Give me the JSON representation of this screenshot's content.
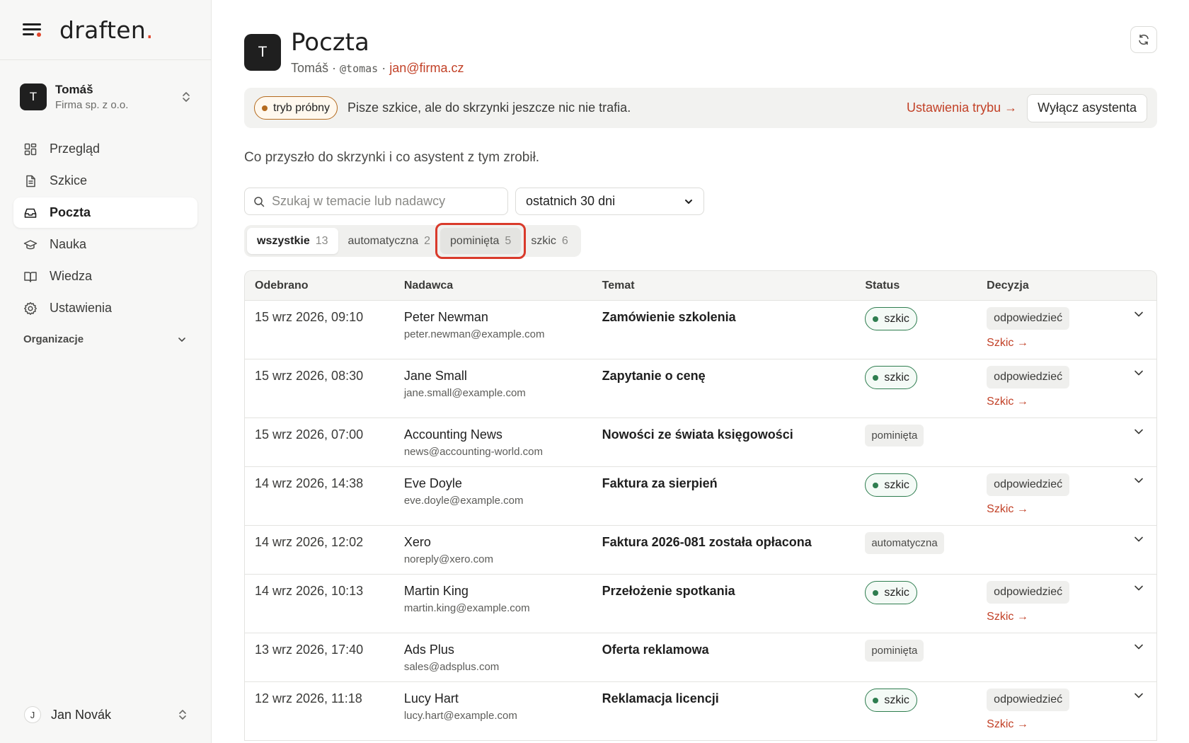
{
  "brand": {
    "logo": "draften",
    "logo_dot": "."
  },
  "account": {
    "initial": "T",
    "name": "Tomáš",
    "org": "Firma sp. z o.o."
  },
  "nav": [
    {
      "label": "Przegląd",
      "icon": "grid-icon",
      "active": false
    },
    {
      "label": "Szkice",
      "icon": "document-icon",
      "active": false
    },
    {
      "label": "Poczta",
      "icon": "inbox-icon",
      "active": true
    },
    {
      "label": "Nauka",
      "icon": "graduation-cap-icon",
      "active": false
    },
    {
      "label": "Wiedza",
      "icon": "book-icon",
      "active": false
    },
    {
      "label": "Ustawienia",
      "icon": "gear-icon",
      "active": false
    }
  ],
  "org_section": {
    "label": "Organizacje"
  },
  "user": {
    "initial": "J",
    "name": "Jan Novák"
  },
  "header": {
    "initial": "T",
    "title": "Poczta",
    "name": "Tomáš",
    "sep1": " · ",
    "handle": "@tomas",
    "sep2": " · ",
    "email": "jan@firma.cz"
  },
  "trial": {
    "pill": "tryb próbny",
    "text": "Pisze szkice, ale do skrzynki jeszcze nic nie trafia.",
    "settings_link": "Ustawienia trybu →",
    "disable_button": "Wyłącz asystenta"
  },
  "intro": "Co przyszło do skrzynki i co asystent z tym zrobił.",
  "search": {
    "placeholder": "Szukaj w temacie lub nadawcy",
    "value": ""
  },
  "range": {
    "selected": "ostatnich 30 dni"
  },
  "filters": [
    {
      "label": "wszystkie",
      "count": "13"
    },
    {
      "label": "automatyczna",
      "count": "2"
    },
    {
      "label": "pominięta",
      "count": "5"
    },
    {
      "label": "szkic",
      "count": "6"
    }
  ],
  "table": {
    "headers": {
      "date": "Odebrano",
      "from": "Nadawca",
      "subject": "Temat",
      "status": "Status",
      "decision": "Decyzja"
    },
    "rows": [
      {
        "date": "15 wrz 2026, 09:10",
        "name": "Peter Newman",
        "email": "peter.newman@example.com",
        "subject": "Zamówienie szkolenia",
        "status": "szkic",
        "decision": "odpowiedzieć",
        "link": "Szkic →"
      },
      {
        "date": "15 wrz 2026, 08:30",
        "name": "Jane Small",
        "email": "jane.small@example.com",
        "subject": "Zapytanie o cenę",
        "status": "szkic",
        "decision": "odpowiedzieć",
        "link": "Szkic →"
      },
      {
        "date": "15 wrz 2026, 07:00",
        "name": "Accounting News",
        "email": "news@accounting-world.com",
        "subject": "Nowości ze świata księgowości",
        "status": "pominięta",
        "decision": "",
        "link": ""
      },
      {
        "date": "14 wrz 2026, 14:38",
        "name": "Eve Doyle",
        "email": "eve.doyle@example.com",
        "subject": "Faktura za sierpień",
        "status": "szkic",
        "decision": "odpowiedzieć",
        "link": "Szkic →"
      },
      {
        "date": "14 wrz 2026, 12:02",
        "name": "Xero",
        "email": "noreply@xero.com",
        "subject": "Faktura 2026-081 została opłacona",
        "status": "automatyczna",
        "decision": "",
        "link": ""
      },
      {
        "date": "14 wrz 2026, 10:13",
        "name": "Martin King",
        "email": "martin.king@example.com",
        "subject": "Przełożenie spotkania",
        "status": "szkic",
        "decision": "odpowiedzieć",
        "link": "Szkic →"
      },
      {
        "date": "13 wrz 2026, 17:40",
        "name": "Ads Plus",
        "email": "sales@adsplus.com",
        "subject": "Oferta reklamowa",
        "status": "pominięta",
        "decision": "",
        "link": ""
      },
      {
        "date": "12 wrz 2026, 11:18",
        "name": "Lucy Hart",
        "email": "lucy.hart@example.com",
        "subject": "Reklamacja licencji",
        "status": "szkic",
        "decision": "odpowiedzieć",
        "link": "Szkic →"
      }
    ]
  },
  "colors": {
    "accent": "#c24127",
    "draft_green": "#2e7d4f",
    "trial_amber": "#b46a1e",
    "highlight_red": "#d93a2b"
  }
}
